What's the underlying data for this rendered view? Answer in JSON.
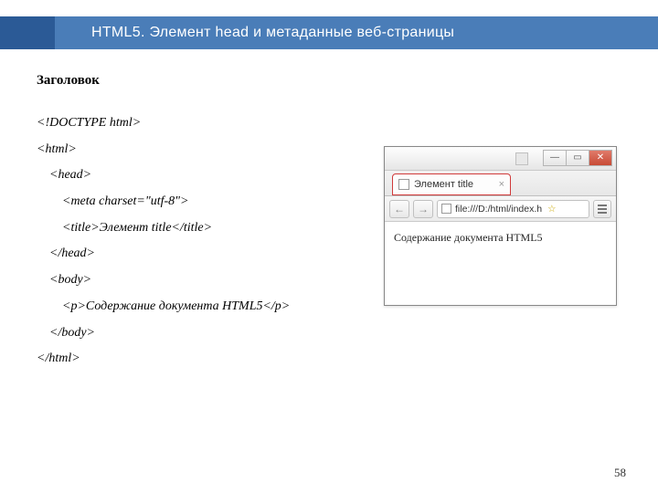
{
  "header": {
    "title": "HTML5. Элемент head и метаданные веб-страницы"
  },
  "section": {
    "subtitle": "Заголовок"
  },
  "code": {
    "l1": "<!DOCTYPE html>",
    "l2": "<html>",
    "l3": "    <head>",
    "l4": "        <meta charset=\"utf-8\">",
    "l5": "        <title>Элемент title</title>",
    "l6": "    </head>",
    "l7": "    <body>",
    "l8": "        <p>Содержание документа HTML5</p>",
    "l9": "    </body>",
    "l10": "</html>"
  },
  "browser": {
    "tab_title": "Элемент title",
    "tab_close": "×",
    "ctrl_min": "—",
    "ctrl_max": "▭",
    "ctrl_close": "✕",
    "nav_back": "←",
    "nav_fwd": "→",
    "url": "file:///D:/html/index.h",
    "star": "☆",
    "body_text": "Содержание документа HTML5"
  },
  "page_number": "58"
}
